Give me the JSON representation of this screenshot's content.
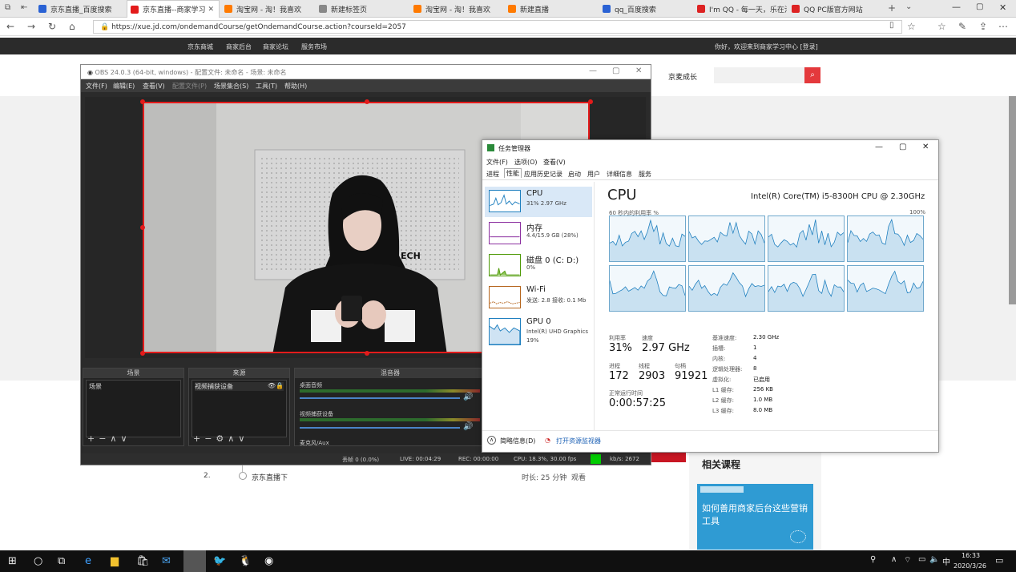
{
  "browser": {
    "tabs": [
      {
        "label": "京东直播_百度搜索",
        "color": "#2a62d4",
        "active": false
      },
      {
        "label": "京东直播--商家学习",
        "color": "#e31b1b",
        "active": true
      },
      {
        "label": "淘宝网 - 淘！我喜欢",
        "color": "#ff7a00",
        "active": false
      },
      {
        "label": "新建标签页",
        "color": "#888888",
        "active": false
      },
      {
        "label": "淘宝网 - 淘！我喜欢",
        "color": "#ff7a00",
        "active": false
      },
      {
        "label": "新建直播",
        "color": "#ff7a00",
        "active": false
      },
      {
        "label": "qq_百度搜索",
        "color": "#2a62d4",
        "active": false
      },
      {
        "label": "I'm QQ - 每一天，乐在沟",
        "color": "#d22",
        "active": false
      },
      {
        "label": "QQ PC版官方网站",
        "color": "#d22",
        "active": false
      }
    ],
    "url": "https://xue.jd.com/ondemandCourse/getOndemandCourse.action?courseId=2057"
  },
  "site": {
    "nav": [
      "京东商城",
      "商家后台",
      "商家论坛",
      "服务市场"
    ],
    "welcome": "你好，欢迎来到商家学习中心 [登录]",
    "growth": "京麦成长"
  },
  "obs": {
    "title": "OBS 24.0.3 (64-bit, windows) - 配置文件: 未命名 - 场景: 未命名",
    "menu": [
      "文件(F)",
      "编辑(E)",
      "查看(V)",
      "配置文件(P)",
      "场景集合(S)",
      "工具(T)",
      "帮助(H)"
    ],
    "docks": {
      "scenes": "场景",
      "sources": "来源",
      "mixer": "混音器"
    },
    "scene_item": "场景",
    "source_item": "视频捕获设备",
    "mixer": {
      "desktop": "桌面音频",
      "mic": "视频捕获设备",
      "aux": "麦克风/Aux"
    },
    "status": {
      "dropped": "丢帧 0 (0.0%)",
      "live": "LIVE: 00:04:29",
      "rec": "REC: 00:00:00",
      "cpu": "CPU: 18.3%, 30.00 fps",
      "kbs": "kb/s: 2672"
    }
  },
  "taskmgr": {
    "title": "任务管理器",
    "menu": [
      "文件(F)",
      "选项(O)",
      "查看(V)"
    ],
    "tabs": [
      "进程",
      "性能",
      "应用历史记录",
      "启动",
      "用户",
      "详细信息",
      "服务"
    ],
    "resources": [
      {
        "name": "CPU",
        "sub": "31% 2.97 GHz",
        "color": "#1e7fbf"
      },
      {
        "name": "内存",
        "sub": "4.4/15.9 GB (28%)",
        "color": "#8b2fa0"
      },
      {
        "name": "磁盘 0 (C: D:)",
        "sub": "0%",
        "color": "#4e9a06"
      },
      {
        "name": "Wi-Fi",
        "sub": "发送: 2.8 接收: 0.1 Mb",
        "color": "#b5651d"
      },
      {
        "name": "GPU 0",
        "sub": "Intel(R) UHD Graphics",
        "sub2": "19%",
        "color": "#1e7fbf"
      }
    ],
    "cpu_heading": "CPU",
    "cpu_model": "Intel(R) Core(TM) i5-8300H CPU @ 2.30GHz",
    "graph_label": "60 秒内的利用率 %",
    "graph_max": "100%",
    "stats": {
      "util_label": "利用率",
      "util": "31%",
      "speed_label": "速度",
      "speed": "2.97 GHz",
      "proc_label": "进程",
      "proc": "172",
      "threads_label": "线程",
      "threads": "2903",
      "handles_label": "句柄",
      "handles": "91921",
      "uptime_label": "正常运行时间",
      "uptime": "0:00:57:25"
    },
    "specs": [
      {
        "k": "基准速度:",
        "v": "2.30 GHz"
      },
      {
        "k": "插槽:",
        "v": "1"
      },
      {
        "k": "内核:",
        "v": "4"
      },
      {
        "k": "逻辑处理器:",
        "v": "8"
      },
      {
        "k": "虚拟化:",
        "v": "已启用"
      },
      {
        "k": "L1 缓存:",
        "v": "256 KB"
      },
      {
        "k": "L2 缓存:",
        "v": "1.0 MB"
      },
      {
        "k": "L3 缓存:",
        "v": "8.0 MB"
      }
    ],
    "less": "简略信息(D)",
    "resmon": "打开资源监视器"
  },
  "course": {
    "num": "2.",
    "name": "京东直播下",
    "duration": "时长: 25 分钟",
    "watch": "观看",
    "related": "相关课程",
    "banner": "如何善用商家后台这些营销工具"
  },
  "taskbar": {
    "time": "16:33",
    "date": "2020/3/26",
    "ime": "中"
  }
}
